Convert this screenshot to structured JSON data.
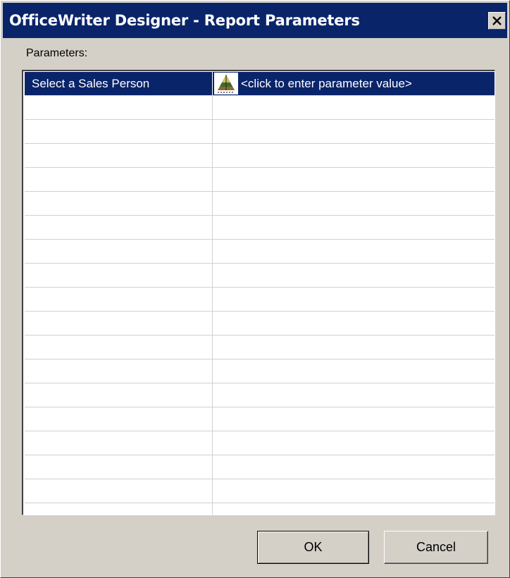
{
  "window": {
    "title": "OfficeWriter Designer - Report Parameters",
    "close_icon": "close-icon"
  },
  "parameters_label": "Parameters:",
  "grid": {
    "rows": [
      {
        "name": "Select a Sales Person",
        "value": "<click to enter parameter value>",
        "value_icon": "pyramid-parameter-icon",
        "selected": true
      }
    ],
    "empty_row_count": 18
  },
  "buttons": {
    "ok": "OK",
    "cancel": "Cancel"
  },
  "colors": {
    "titlebar": "#0a246a",
    "selection": "#0a246a",
    "face": "#d4d0c8",
    "gridline": "#d0d0d0"
  }
}
